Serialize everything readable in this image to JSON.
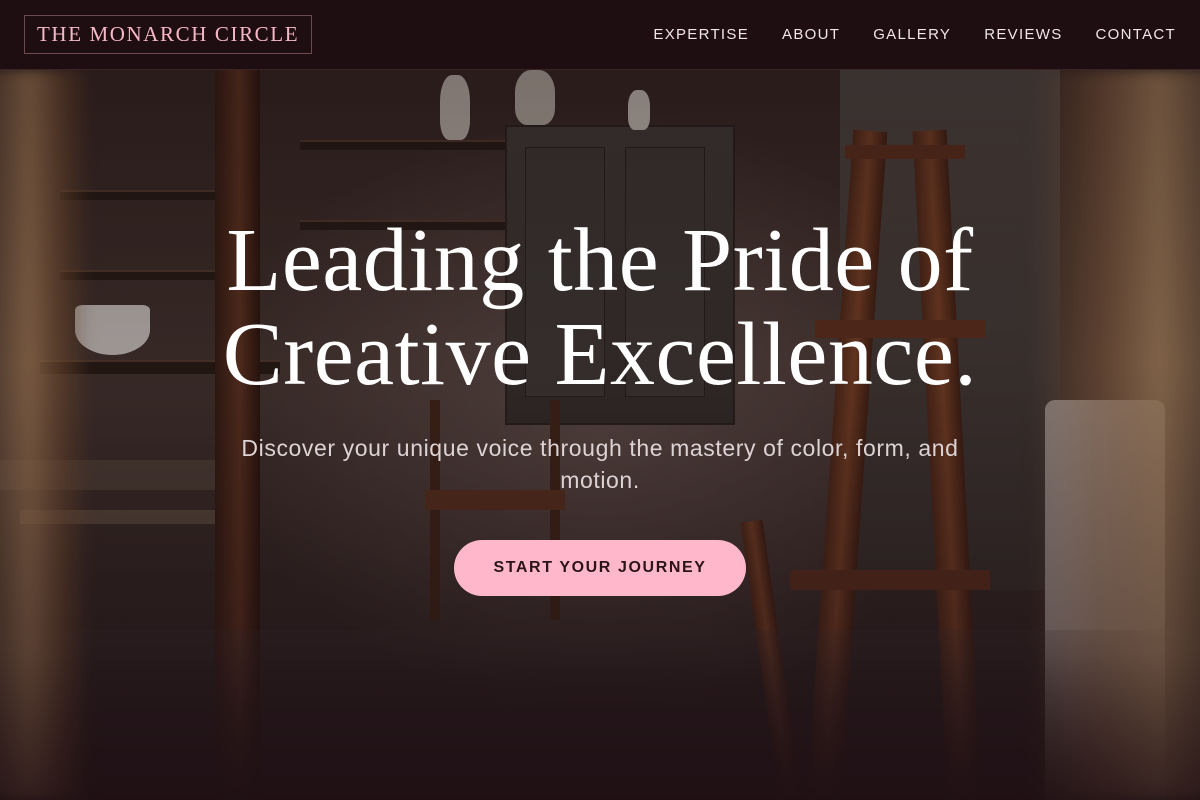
{
  "header": {
    "brand": "THE MONARCH CIRCLE",
    "nav": [
      {
        "label": "EXPERTISE"
      },
      {
        "label": "ABOUT"
      },
      {
        "label": "GALLERY"
      },
      {
        "label": "REVIEWS"
      },
      {
        "label": "CONTACT"
      }
    ]
  },
  "hero": {
    "title": "Leading the Pride of Creative Excellence.",
    "subtitle": "Discover your unique voice through the mastery of color, form, and motion.",
    "cta_label": "START YOUR JOURNEY",
    "background_icon": "art-studio-photo"
  },
  "colors": {
    "nav_background": "#1f0e11",
    "brand_text": "#f5b8c8",
    "cta_background": "#ffb8cb",
    "cta_text": "#2a1418"
  }
}
